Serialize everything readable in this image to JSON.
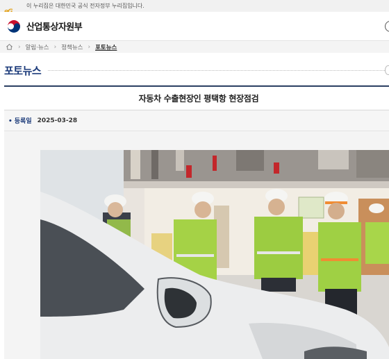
{
  "gov_banner": {
    "logo_text": "eG",
    "text": "이 누리집은 대한민국 공식 전자정부 누리집입니다."
  },
  "header": {
    "org_name": "산업통상자원부"
  },
  "breadcrumb": {
    "items": [
      "알림·뉴스",
      "정책뉴스",
      "포토뉴스"
    ]
  },
  "page": {
    "title": "포토뉴스"
  },
  "article": {
    "title": "자동차 수출현장인 평택항 현장점검",
    "meta_label": "등록일",
    "date": "2025-03-28"
  },
  "colors": {
    "accent": "#1b3a7a",
    "banner_bg": "#f1f1f1",
    "vest": "#8fd13f"
  }
}
